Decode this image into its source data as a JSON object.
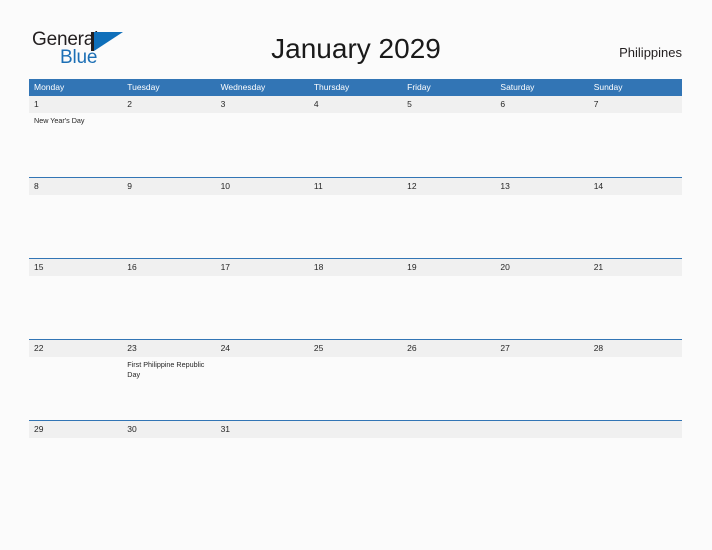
{
  "brand": {
    "name_part1": "General",
    "name_part2": "Blue",
    "mark": "triangle-logo-mark",
    "color_primary": "#1c6fb5",
    "color_text": "#231f20"
  },
  "header": {
    "title": "January 2029",
    "country": "Philippines"
  },
  "theme": {
    "header_blue": "#3275b5",
    "band_gray": "#f0f0f0",
    "page_bg": "#fbfbfb",
    "text": "#262626"
  },
  "calendar": {
    "month": "January",
    "year": "2029",
    "weekday_headers": [
      "Monday",
      "Tuesday",
      "Wednesday",
      "Thursday",
      "Friday",
      "Saturday",
      "Sunday"
    ],
    "weeks": [
      {
        "days": [
          {
            "num": "1",
            "events": [
              "New Year's Day"
            ]
          },
          {
            "num": "2",
            "events": []
          },
          {
            "num": "3",
            "events": []
          },
          {
            "num": "4",
            "events": []
          },
          {
            "num": "5",
            "events": []
          },
          {
            "num": "6",
            "events": []
          },
          {
            "num": "7",
            "events": []
          }
        ]
      },
      {
        "days": [
          {
            "num": "8",
            "events": []
          },
          {
            "num": "9",
            "events": []
          },
          {
            "num": "10",
            "events": []
          },
          {
            "num": "11",
            "events": []
          },
          {
            "num": "12",
            "events": []
          },
          {
            "num": "13",
            "events": []
          },
          {
            "num": "14",
            "events": []
          }
        ]
      },
      {
        "days": [
          {
            "num": "15",
            "events": []
          },
          {
            "num": "16",
            "events": []
          },
          {
            "num": "17",
            "events": []
          },
          {
            "num": "18",
            "events": []
          },
          {
            "num": "19",
            "events": []
          },
          {
            "num": "20",
            "events": []
          },
          {
            "num": "21",
            "events": []
          }
        ]
      },
      {
        "days": [
          {
            "num": "22",
            "events": []
          },
          {
            "num": "23",
            "events": [
              "First Philippine Republic Day"
            ]
          },
          {
            "num": "24",
            "events": []
          },
          {
            "num": "25",
            "events": []
          },
          {
            "num": "26",
            "events": []
          },
          {
            "num": "27",
            "events": []
          },
          {
            "num": "28",
            "events": []
          }
        ]
      },
      {
        "days": [
          {
            "num": "29",
            "events": []
          },
          {
            "num": "30",
            "events": []
          },
          {
            "num": "31",
            "events": []
          },
          {
            "num": "",
            "events": []
          },
          {
            "num": "",
            "events": []
          },
          {
            "num": "",
            "events": []
          },
          {
            "num": "",
            "events": []
          }
        ]
      }
    ]
  }
}
